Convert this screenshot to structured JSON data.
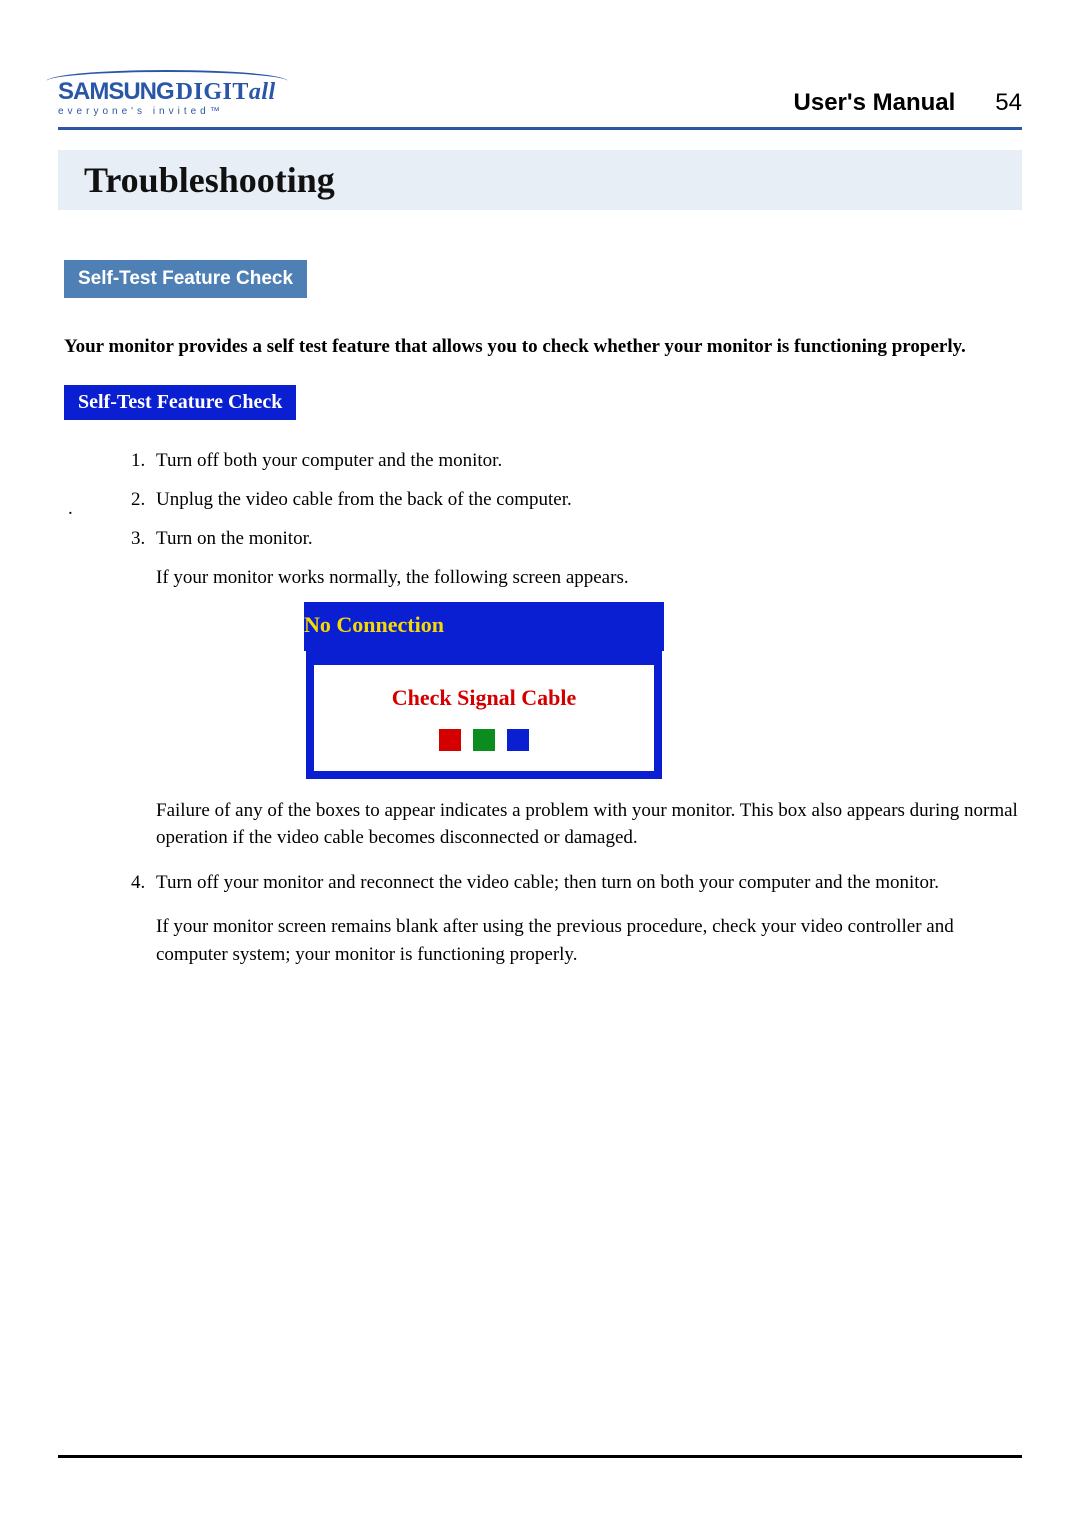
{
  "logo": {
    "brand_1": "SAMSUNG",
    "brand_2": "DIGIT",
    "brand_3": "all",
    "tagline": "everyone's invited™"
  },
  "header": {
    "manual_title": "User's Manual",
    "page_number": "54"
  },
  "title": "Troubleshooting",
  "section_tab": "Self-Test Feature Check",
  "intro": "Your monitor provides a self test feature that allows you to check whether your monitor is functioning properly.",
  "subheading": "Self-Test Feature Check",
  "steps": {
    "s1": "Turn off both your computer and the monitor.",
    "s2": "Unplug the video cable from the back of the computer.",
    "s3": "Turn on the monitor.",
    "s3_note": "If your monitor works normally, the following screen appears.",
    "s3_failure": "Failure of any of the boxes to appear indicates a problem with your monitor. This box also appears during normal operation if the video cable becomes disconnected or damaged.",
    "s4": "Turn off your monitor and reconnect the video cable; then turn on both your computer and the monitor.",
    "s4_note": "If your monitor screen remains blank after using the previous procedure, check your video controller and computer system; your monitor is functioning properly."
  },
  "screen": {
    "title": "No Connection",
    "subtitle": "Check Signal Cable"
  },
  "stray": "."
}
